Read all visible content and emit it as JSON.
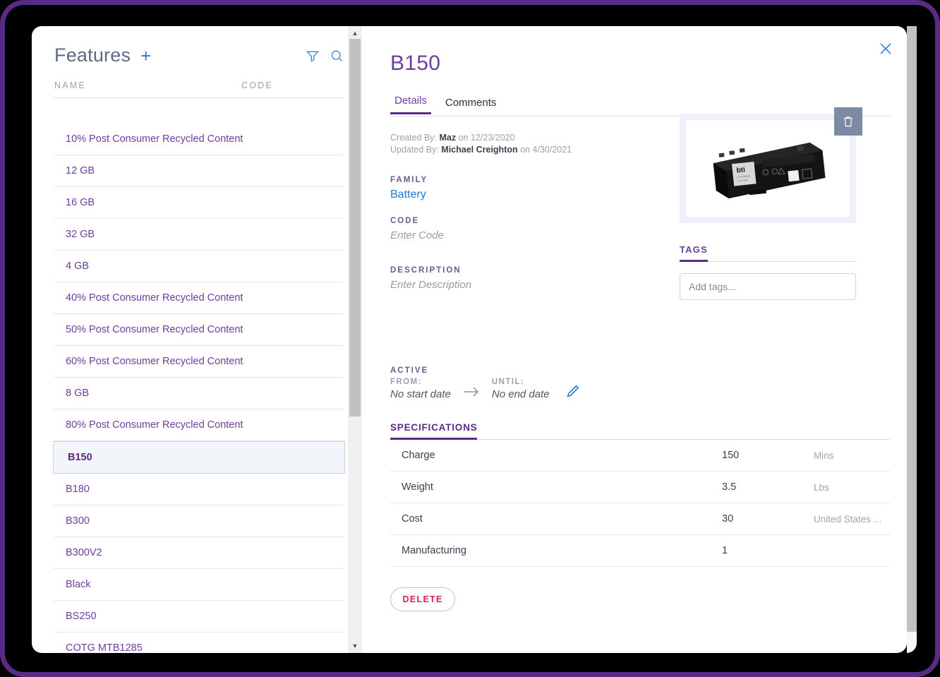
{
  "frame": {
    "border_color": "#5b2a86",
    "background": "#000000"
  },
  "list": {
    "title": "Features",
    "add_label": "+",
    "icons": {
      "filter": "filter-icon",
      "search": "search-icon"
    },
    "columns": {
      "name": "NAME",
      "code": "CODE"
    },
    "items": [
      {
        "name": "10% Post Consumer Recycled Content",
        "code": "",
        "selected": false
      },
      {
        "name": "12 GB",
        "code": "",
        "selected": false
      },
      {
        "name": "16 GB",
        "code": "",
        "selected": false
      },
      {
        "name": "32 GB",
        "code": "",
        "selected": false
      },
      {
        "name": "4 GB",
        "code": "",
        "selected": false
      },
      {
        "name": "40% Post Consumer Recycled Content",
        "code": "",
        "selected": false
      },
      {
        "name": "50% Post Consumer Recycled Content",
        "code": "",
        "selected": false
      },
      {
        "name": "60% Post Consumer Recycled Content",
        "code": "",
        "selected": false
      },
      {
        "name": "8 GB",
        "code": "",
        "selected": false
      },
      {
        "name": "80% Post Consumer Recycled Content",
        "code": "",
        "selected": false
      },
      {
        "name": "B150",
        "code": "",
        "selected": true
      },
      {
        "name": "B180",
        "code": "",
        "selected": false
      },
      {
        "name": "B300",
        "code": "",
        "selected": false
      },
      {
        "name": "B300V2",
        "code": "",
        "selected": false
      },
      {
        "name": "Black",
        "code": "",
        "selected": false
      },
      {
        "name": "BS250",
        "code": "",
        "selected": false
      },
      {
        "name": "COTG MTB1285",
        "code": "",
        "selected": false
      }
    ]
  },
  "detail": {
    "title": "B150",
    "close_label": "✕",
    "tabs": [
      {
        "label": "Details",
        "active": true
      },
      {
        "label": "Comments",
        "active": false
      }
    ],
    "meta": {
      "created_prefix": "Created By:",
      "created_by": "Maz",
      "created_on": "on 12/23/2020",
      "updated_prefix": "Updated By:",
      "updated_by": "Michael Creighton",
      "updated_on": "on 4/30/2021"
    },
    "family": {
      "label": "FAMILY",
      "value": "Battery"
    },
    "code": {
      "label": "CODE",
      "placeholder": "Enter Code"
    },
    "description": {
      "label": "DESCRIPTION",
      "placeholder": "Enter Description"
    },
    "active": {
      "label": "ACTIVE",
      "from_label": "FROM:",
      "from_value": "No start date",
      "until_label": "UNTIL:",
      "until_value": "No end date",
      "edit_icon": "pencil-icon",
      "arrow_icon": "arrow-right-icon"
    },
    "image": {
      "alt": "battery-product-image",
      "brand": "bti",
      "delete_icon": "trash-icon"
    },
    "tags": {
      "label": "TAGS",
      "placeholder": "Add tags...",
      "value": ""
    },
    "specifications": {
      "label": "SPECIFICATIONS",
      "rows": [
        {
          "name": "Charge",
          "value": "150",
          "unit": "Mins"
        },
        {
          "name": "Weight",
          "value": "3.5",
          "unit": "Lbs"
        },
        {
          "name": "Cost",
          "value": "30",
          "unit": "United States ..."
        },
        {
          "name": "Manufacturing",
          "value": "1",
          "unit": ""
        }
      ]
    },
    "delete_button": {
      "label": "DELETE",
      "color": "#d81e5b"
    }
  }
}
